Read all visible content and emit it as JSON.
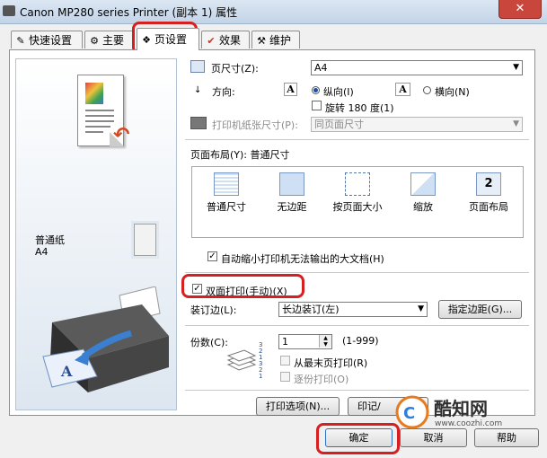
{
  "window": {
    "title": "Canon MP280 series Printer (副本 1) 属性",
    "close_glyph": "✕"
  },
  "tabs": [
    {
      "label": "快速设置",
      "icon": "quick-setup-icon",
      "glyph": "✎"
    },
    {
      "label": "主要",
      "icon": "main-icon",
      "glyph": "⚙"
    },
    {
      "label": "页设置",
      "icon": "page-setup-icon",
      "glyph": "❖",
      "active": true
    },
    {
      "label": "效果",
      "icon": "effects-icon",
      "glyph": "✔"
    },
    {
      "label": "维护",
      "icon": "maintenance-icon",
      "glyph": "⚒"
    }
  ],
  "preview": {
    "media_type": "普通纸",
    "paper": "A4"
  },
  "page_size": {
    "label": "页尺寸(Z):",
    "value": "A4"
  },
  "orientation": {
    "label": "方向:",
    "portrait": "纵向(I)",
    "landscape": "横向(N)",
    "selected": "portrait",
    "rotate_label": "旋转 180 度(1)",
    "rotate_checked": false,
    "portrait_glyph": "A",
    "landscape_glyph": "A"
  },
  "printer_paper_size": {
    "label": "打印机纸张尺寸(P):",
    "value": "同页面尺寸"
  },
  "page_layout": {
    "label": "页面布局(Y): 普通尺寸",
    "items": [
      {
        "label": "普通尺寸",
        "icon": "normal-size-icon"
      },
      {
        "label": "无边距",
        "icon": "borderless-icon"
      },
      {
        "label": "按页面大小",
        "icon": "fit-to-page-icon"
      },
      {
        "label": "缩放",
        "icon": "scaled-icon"
      },
      {
        "label": "页面布局",
        "icon": "page-layout-icon",
        "glyph": "2"
      }
    ]
  },
  "auto_reduce": {
    "label": "自动缩小打印机无法输出的大文档(H)",
    "checked": true
  },
  "duplex": {
    "label": "双面打印(手动)(X)",
    "checked": true
  },
  "binding": {
    "label": "装订边(L):",
    "value": "长边装订(左)",
    "margin_button": "指定边距(G)..."
  },
  "copies": {
    "label": "份数(C):",
    "value": "1",
    "range": "(1-999)",
    "last_page_first": "从最末页打印(R)",
    "collate": "逐份打印(O)"
  },
  "bottom_buttons": {
    "print_options": "打印选项(N)...",
    "stamp": "印记/"
  },
  "dialog_buttons": {
    "ok": "确定",
    "cancel": "取消",
    "help": "帮助"
  },
  "watermark": {
    "brand": "酷知网",
    "url": "www.coozhi.com"
  },
  "colors": {
    "highlight": "#d62020",
    "accent": "#1a4ea8",
    "printer_arrow": "#3a7fd0"
  }
}
